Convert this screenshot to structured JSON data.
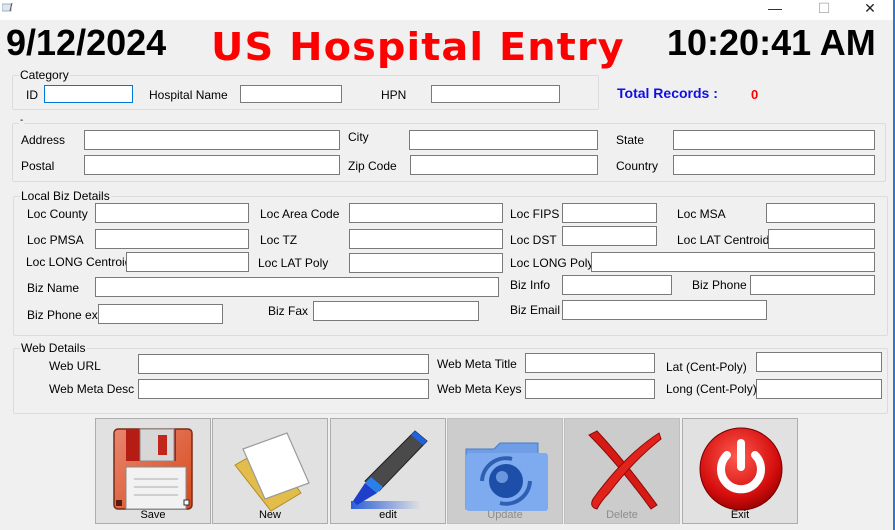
{
  "window": {
    "controls": {
      "minimize": "—",
      "maximize": "☐",
      "close": "✕"
    }
  },
  "header": {
    "date": "9/12/2024",
    "title": "US Hospital Entry",
    "time": "10:20:41 AM",
    "title_color": "#ff0000"
  },
  "category": {
    "legend": "Category",
    "id_label": "ID",
    "id_value": "",
    "hospital_name_label": "Hospital Name",
    "hospital_name_value": "",
    "hpn_label": "HPN",
    "hpn_value": ""
  },
  "totals": {
    "label": "Total Records :",
    "value": "0"
  },
  "address": {
    "legend": "-",
    "address_label": "Address",
    "address_value": "",
    "city_label": "City",
    "city_value": "",
    "state_label": "State",
    "state_value": "",
    "postal_label": "Postal",
    "postal_value": "",
    "zip_label": "Zip Code",
    "zip_value": "",
    "country_label": "Country",
    "country_value": ""
  },
  "local_biz": {
    "legend": "Local  Biz Details",
    "loc_county": "Loc County",
    "loc_area_code": "Loc Area Code",
    "loc_fips": "Loc FIPS",
    "loc_msa": "Loc MSA",
    "loc_pmsa": "Loc PMSA",
    "loc_tz": "Loc TZ",
    "loc_dst": "Loc DST",
    "loc_lat_centroid": "Loc LAT Centroid",
    "loc_long_centroid": "Loc LONG Centroid",
    "loc_lat_poly": "Loc LAT Poly",
    "loc_long_poly": "Loc LONG Poly",
    "biz_name": "Biz Name",
    "biz_info": "Biz Info",
    "biz_phone": "Biz Phone",
    "biz_phone_ext": "Biz Phone ext",
    "biz_fax": "Biz Fax",
    "biz_email": "Biz Email"
  },
  "web": {
    "legend": "Web Details",
    "web_url": "Web URL",
    "web_meta_title": "Web Meta Title",
    "lat_cent_poly": "Lat (Cent-Poly)",
    "web_meta_desc": "Web Meta Desc",
    "web_meta_keys": "Web Meta Keys",
    "long_cent_poly": "Long (Cent-Poly)"
  },
  "toolbar": {
    "save": "Save",
    "new": "New",
    "edit": "edit",
    "update": "Update",
    "delete": "Delete",
    "exit": "Exit"
  }
}
